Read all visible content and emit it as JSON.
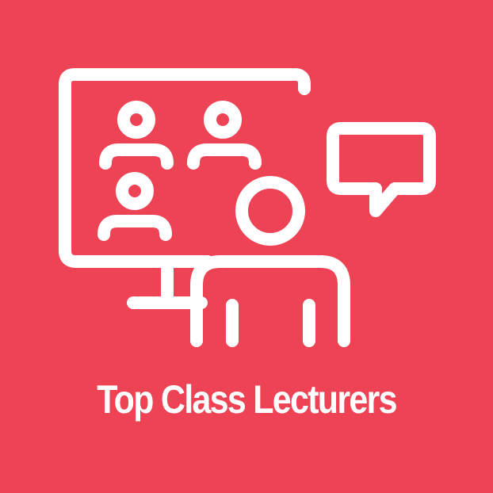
{
  "tile": {
    "caption": "Top Class Lecturers",
    "background_color": "#EE4255",
    "foreground_color": "#FFFFFF"
  },
  "icons": {
    "monitor": "monitor-icon",
    "attendees": "person-icon",
    "speech_bubble": "speech-bubble-icon",
    "lecturer": "lecturer-icon"
  }
}
